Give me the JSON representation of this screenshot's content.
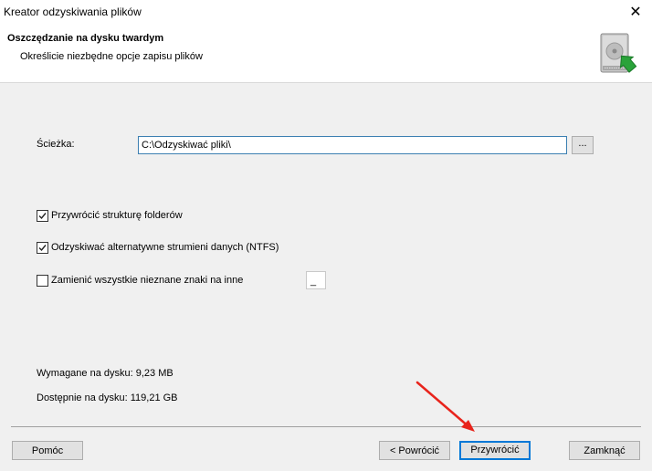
{
  "window": {
    "title": "Kreator odzyskiwania plików",
    "close_glyph": "✕"
  },
  "header": {
    "title": "Oszczędzanie na dysku twardym",
    "subtitle": "Określicie niezbędne opcje zapisu plików",
    "icon": "hard-drive-restore-icon"
  },
  "path": {
    "label": "Ścieżka:",
    "value": "C:\\Odzyskiwać pliki\\",
    "browse_label": "..."
  },
  "options": [
    {
      "label": "Przywrócić strukturę folderów",
      "checked": true
    },
    {
      "label": "Odzyskiwać alternatywne strumieni danych (NTFS)",
      "checked": true
    },
    {
      "label": "Zamienić wszystkie nieznane znaki na inne",
      "checked": false
    }
  ],
  "replacement_char": "_",
  "disk": {
    "required": "Wymagane na dysku: 9,23 MB",
    "available": "Dostępnie na dysku: 119,21 GB"
  },
  "buttons": {
    "help": "Pomóc",
    "back": "< Powrócić",
    "restore": "Przywrócić",
    "close": "Zamknąć"
  },
  "colors": {
    "accent": "#0078d7",
    "annotation_arrow": "#e8241c"
  }
}
